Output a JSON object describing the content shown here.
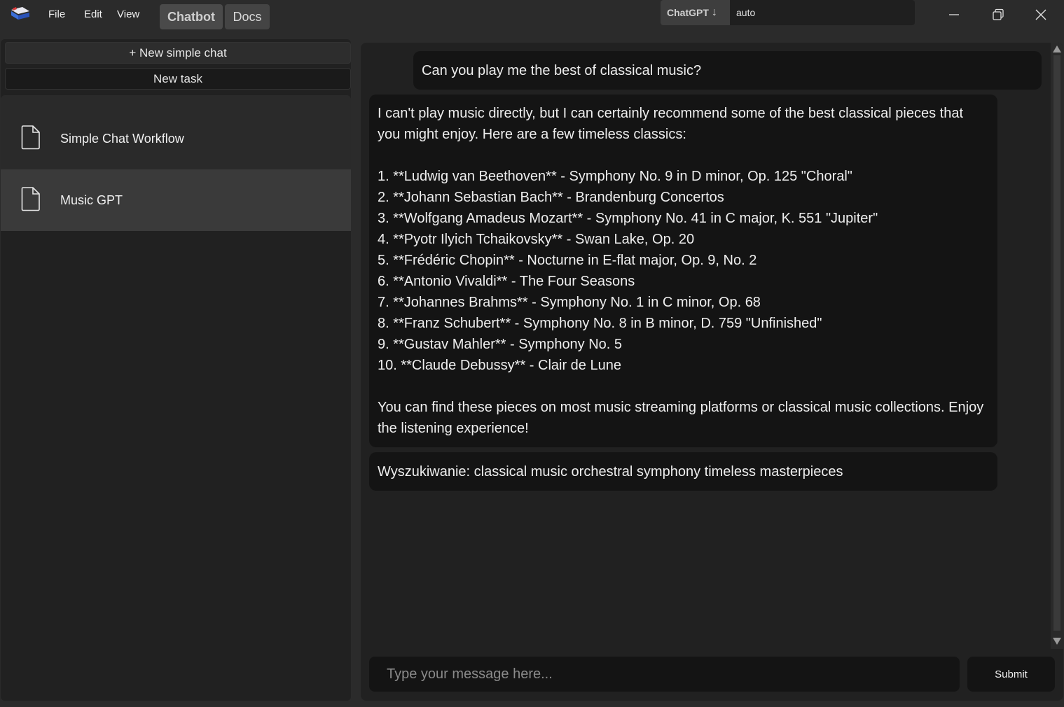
{
  "menu": {
    "file": "File",
    "edit": "Edit",
    "view": "View"
  },
  "tabs": {
    "chatbot": "Chatbot",
    "docs": "Docs"
  },
  "model": {
    "name": "ChatGPT",
    "sort_glyph": "↓",
    "value": "auto"
  },
  "window": {
    "minimize_glyph": "—",
    "restore_glyph": "⧉",
    "close_glyph": "✕"
  },
  "sidebar": {
    "new_chat_label": "+ New simple chat",
    "new_task_label": "New task",
    "items": [
      {
        "label": "Simple Chat Workflow"
      },
      {
        "label": "Music GPT"
      }
    ]
  },
  "chat": {
    "user_message": "Can you play me the best of classical music?",
    "bot_message": "I can't play music directly, but I can certainly recommend some of the best classical pieces that you might enjoy. Here are a few timeless classics:\n\n1. **Ludwig van Beethoven** - Symphony No. 9 in D minor, Op. 125 \"Choral\"\n2. **Johann Sebastian Bach** - Brandenburg Concertos\n3. **Wolfgang Amadeus Mozart** - Symphony No. 41 in C major, K. 551 \"Jupiter\"\n4. **Pyotr Ilyich Tchaikovsky** - Swan Lake, Op. 20\n5. **Frédéric Chopin** - Nocturne in E-flat major, Op. 9, No. 2\n6. **Antonio Vivaldi** - The Four Seasons\n7. **Johannes Brahms** - Symphony No. 1 in C minor, Op. 68\n8. **Franz Schubert** - Symphony No. 8 in B minor, D. 759 \"Unfinished\"\n9. **Gustav Mahler** - Symphony No. 5\n10. **Claude Debussy** - Clair de Lune\n\nYou can find these pieces on most music streaming platforms or classical music collections. Enjoy the listening experience!",
    "search_message": "Wyszukiwanie: classical music orchestral symphony timeless masterpieces",
    "input_placeholder": "Type your message here...",
    "submit_label": "Submit"
  },
  "colors": {
    "background": "#2b2b2b",
    "panel": "#212121",
    "bubble": "#141414",
    "selected_item": "#3a3a3a"
  }
}
